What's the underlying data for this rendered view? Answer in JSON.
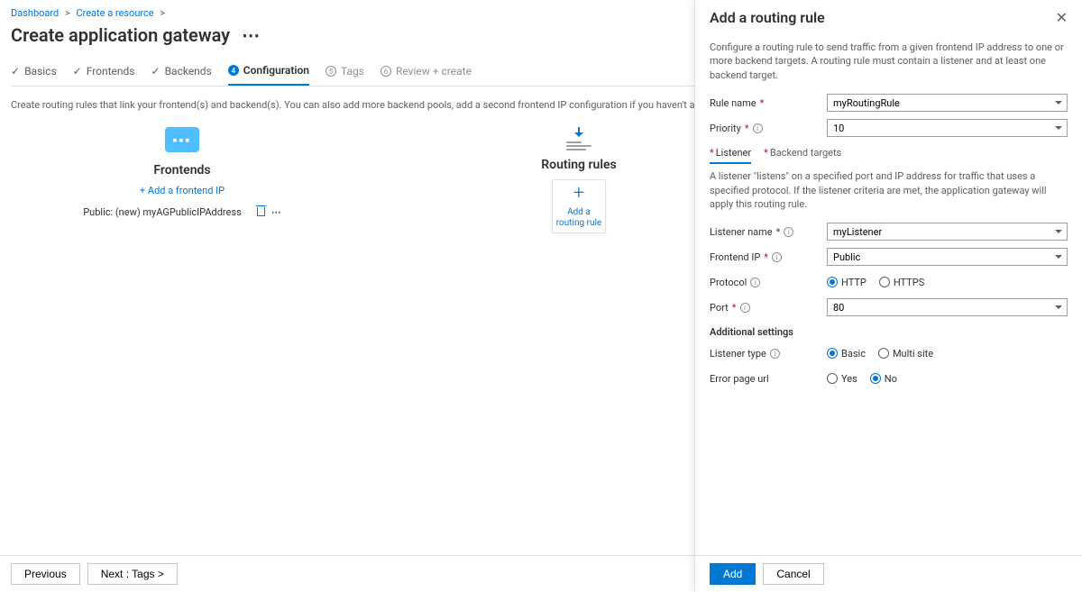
{
  "breadcrumb": {
    "items": [
      "Dashboard",
      "Create a resource"
    ]
  },
  "page": {
    "title": "Create application gateway"
  },
  "steps": {
    "items": [
      {
        "label": "Basics",
        "state": "done"
      },
      {
        "label": "Frontends",
        "state": "done"
      },
      {
        "label": "Backends",
        "state": "done"
      },
      {
        "label": "Configuration",
        "state": "active",
        "num": "4"
      },
      {
        "label": "Tags",
        "state": "todo",
        "num": "5"
      },
      {
        "label": "Review + create",
        "state": "todo",
        "num": "6"
      }
    ]
  },
  "config": {
    "hint": "Create routing rules that link your frontend(s) and backend(s). You can also add more backend pools, add a second frontend IP configuration if you haven't already, or edit previous configurations.",
    "frontends": {
      "title": "Frontends",
      "add_link": "+ Add a frontend IP",
      "items": [
        {
          "label": "Public: (new) myAGPublicIPAddress"
        }
      ]
    },
    "rules": {
      "title": "Routing rules",
      "add_card": "Add a routing rule"
    }
  },
  "footer": {
    "prev": "Previous",
    "next": "Next : Tags >"
  },
  "panel": {
    "title": "Add a routing rule",
    "desc": "Configure a routing rule to send traffic from a given frontend IP address to one or more backend targets. A routing rule must contain a listener and at least one backend target.",
    "rule_name": {
      "label": "Rule name",
      "value": "myRoutingRule"
    },
    "priority": {
      "label": "Priority",
      "value": "10"
    },
    "subtabs": {
      "listener": "Listener",
      "backend": "Backend targets"
    },
    "listener_desc": "A listener \"listens\" on a specified port and IP address for traffic that uses a specified protocol. If the listener criteria are met, the application gateway will apply this routing rule.",
    "listener_name": {
      "label": "Listener name",
      "value": "myListener"
    },
    "frontend_ip": {
      "label": "Frontend IP",
      "value": "Public"
    },
    "protocol": {
      "label": "Protocol",
      "http": "HTTP",
      "https": "HTTPS",
      "selected": "HTTP"
    },
    "port": {
      "label": "Port",
      "value": "80"
    },
    "additional_hdr": "Additional settings",
    "listener_type": {
      "label": "Listener type",
      "basic": "Basic",
      "multi": "Multi site",
      "selected": "Basic"
    },
    "error_page": {
      "label": "Error page url",
      "yes": "Yes",
      "no": "No",
      "selected": "No"
    },
    "footer": {
      "add": "Add",
      "cancel": "Cancel"
    }
  }
}
